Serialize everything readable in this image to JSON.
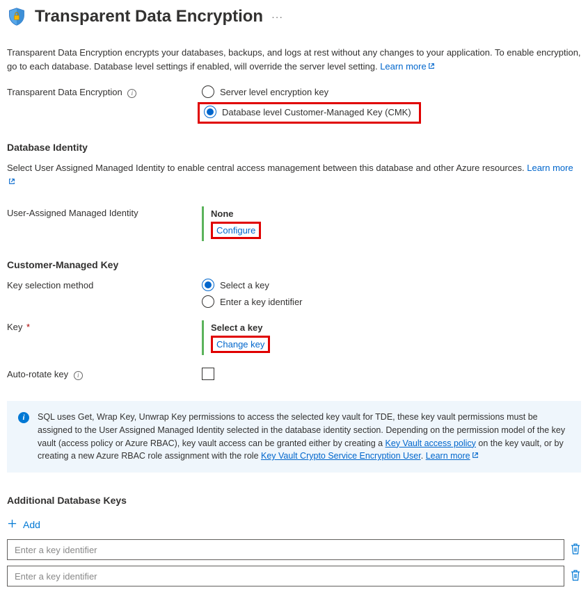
{
  "header": {
    "title": "Transparent Data Encryption",
    "more_actions_label": "More actions"
  },
  "intro": {
    "text": "Transparent Data Encryption encrypts your databases, backups, and logs at rest without any changes to your application. To enable encryption, go to each database. Database level settings if enabled, will override the server level setting. ",
    "learn_more": "Learn more"
  },
  "tde_section": {
    "label": "Transparent Data Encryption",
    "options": {
      "server": "Server level encryption key",
      "db_cmk": "Database level Customer-Managed Key (CMK)"
    }
  },
  "db_identity": {
    "heading": "Database Identity",
    "desc": "Select User Assigned Managed Identity to enable central access management between this database and other Azure resources. ",
    "learn_more": "Learn more",
    "uami_label": "User-Assigned Managed Identity",
    "uami_value": "None",
    "configure_link": "Configure"
  },
  "cmk": {
    "heading": "Customer-Managed Key",
    "key_selection_label": "Key selection method",
    "options": {
      "select_key": "Select a key",
      "enter_identifier": "Enter a key identifier"
    },
    "key_label": "Key",
    "key_value": "Select a key",
    "change_key_link": "Change key",
    "autorotate_label": "Auto-rotate key"
  },
  "banner": {
    "text1": "SQL uses Get, Wrap Key, Unwrap Key permissions to access the selected key vault for TDE, these key vault permissions must be assigned to the User Assigned Managed Identity selected in the database identity section. Depending on the permission model of the key vault (access policy or Azure RBAC), key vault access can be granted either by creating a ",
    "link1": "Key Vault access policy",
    "text2": " on the key vault, or by creating a new Azure RBAC role assignment with the role ",
    "link2": "Key Vault Crypto Service Encryption User",
    "text3": ". ",
    "learn_more": "Learn more"
  },
  "additional_keys": {
    "heading": "Additional Database Keys",
    "add_label": "Add",
    "placeholder": "Enter a key identifier",
    "rows": [
      "",
      ""
    ]
  }
}
